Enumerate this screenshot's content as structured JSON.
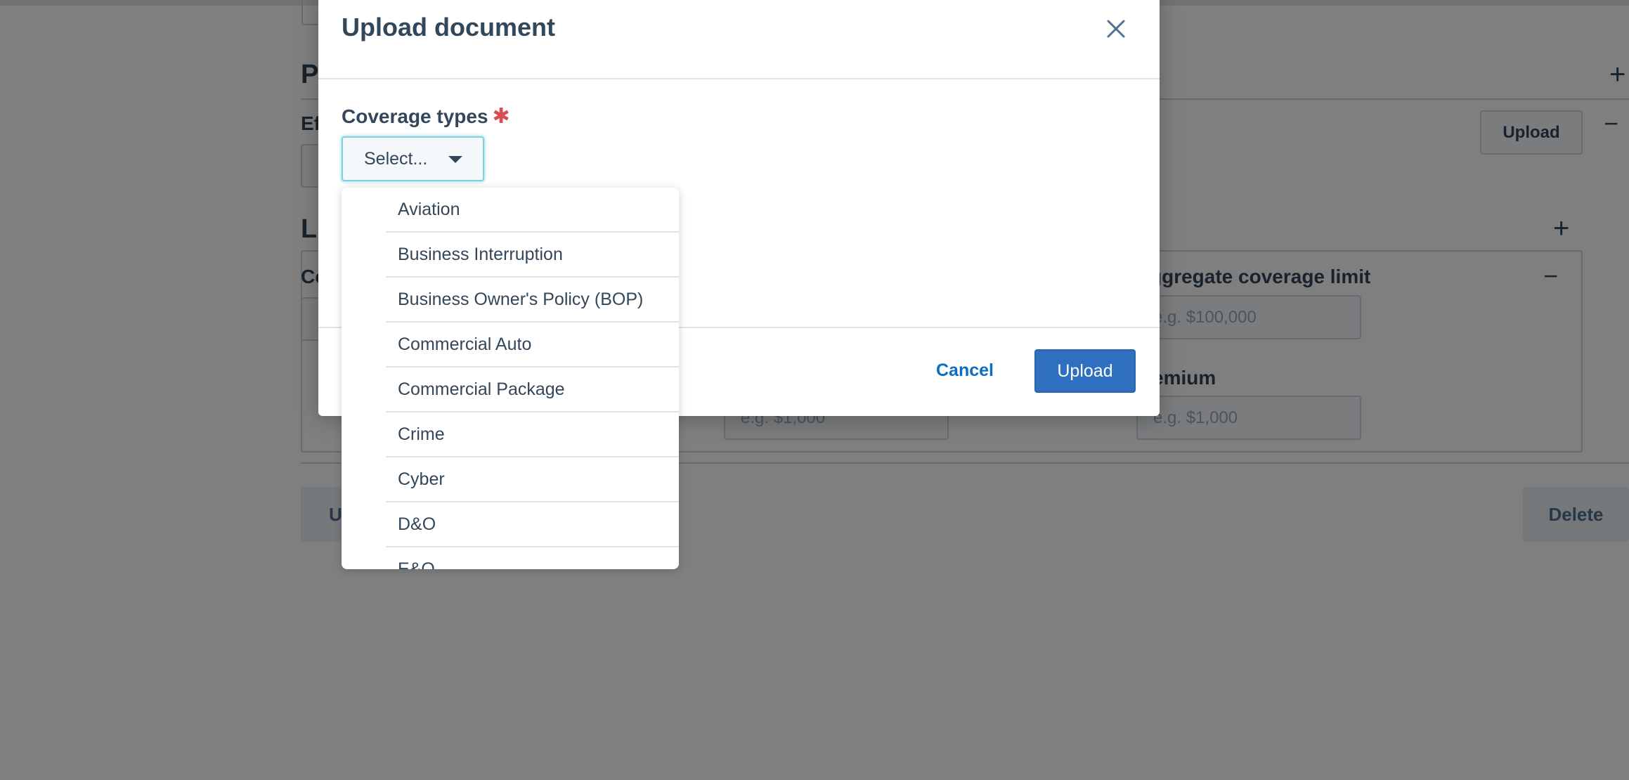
{
  "background": {
    "section1_heading": "P",
    "effective_label": "Ef",
    "upload_button": "Upload",
    "section2_heading": "Li",
    "coverage_label": "Co",
    "aggregate_label": "ggregate coverage limit",
    "aggregate_placeholder": "e.g. $100,000",
    "premium_label": "emium",
    "premium_placeholder": "e.g. $1,000",
    "mid_placeholder": "e.g. $1,000",
    "left_button": "U",
    "delete_button": "Delete",
    "plus_icon": "+",
    "minus_icon": "−"
  },
  "modal": {
    "title": "Upload document",
    "close_icon": "close-icon",
    "field": {
      "label": "Coverage types",
      "required_mark": "✱",
      "select_text": "Select..."
    },
    "cancel_label": "Cancel",
    "upload_label": "Upload"
  },
  "dropdown": {
    "options": [
      "Aviation",
      "Business Interruption",
      "Business Owner's Policy (BOP)",
      "Commercial Auto",
      "Commercial Package",
      "Crime",
      "Cyber",
      "D&O",
      "E&O"
    ]
  },
  "colors": {
    "text": "#33475b",
    "primary": "#2f6fbf",
    "link": "#0b6ec3",
    "required": "#d94c53",
    "overlay": "rgba(0,0,0,0.5)"
  }
}
